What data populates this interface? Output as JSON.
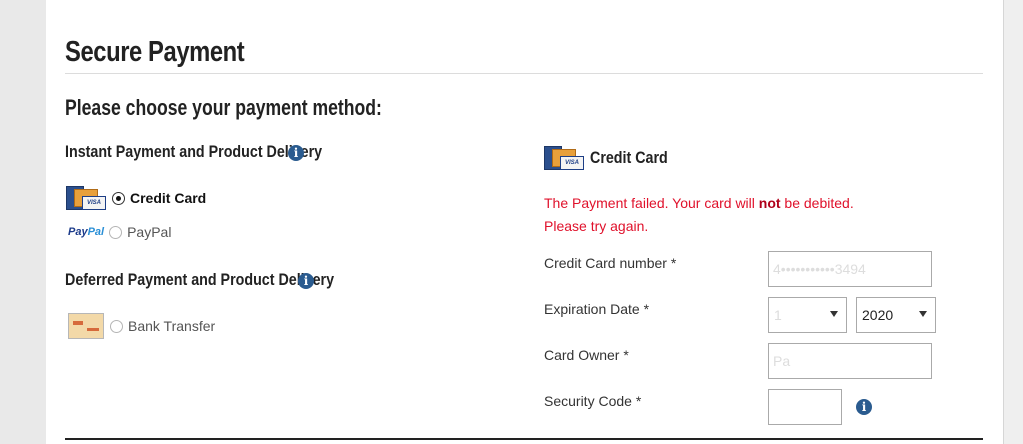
{
  "page": {
    "title": "Secure Payment",
    "subtitle": "Please choose your payment method:"
  },
  "methods": {
    "instant_heading": "Instant Payment and Product Delivery",
    "deferred_heading": "Deferred Payment and Product Delivery",
    "options": [
      {
        "label": "Credit Card",
        "logo": "credit-card-logo",
        "selected": true
      },
      {
        "label": "PayPal",
        "logo": "paypal-logo",
        "selected": false
      },
      {
        "label": "Bank Transfer",
        "logo": "bank-transfer-logo",
        "selected": false
      }
    ],
    "paypal_logo_text": {
      "part1": "Pay",
      "part2": "Pal"
    },
    "visa_text": "VISA"
  },
  "form": {
    "title": "Credit Card",
    "error_part1": "The Payment failed. Your card will ",
    "error_bold": "not",
    "error_part2": " be debited.",
    "error_line2": "Please try again.",
    "card_number_label": "Credit Card number *",
    "card_number_value": "4•••••••••••3494",
    "expiration_label": "Expiration Date *",
    "expiration_month": "1",
    "expiration_year": "2020",
    "owner_label": "Card Owner *",
    "owner_value": "Pa",
    "security_label": "Security Code *",
    "security_value": ""
  },
  "colors": {
    "error": "#e0112b",
    "info_icon": "#2a5b8f",
    "page_bg": "#e9e9e9"
  }
}
